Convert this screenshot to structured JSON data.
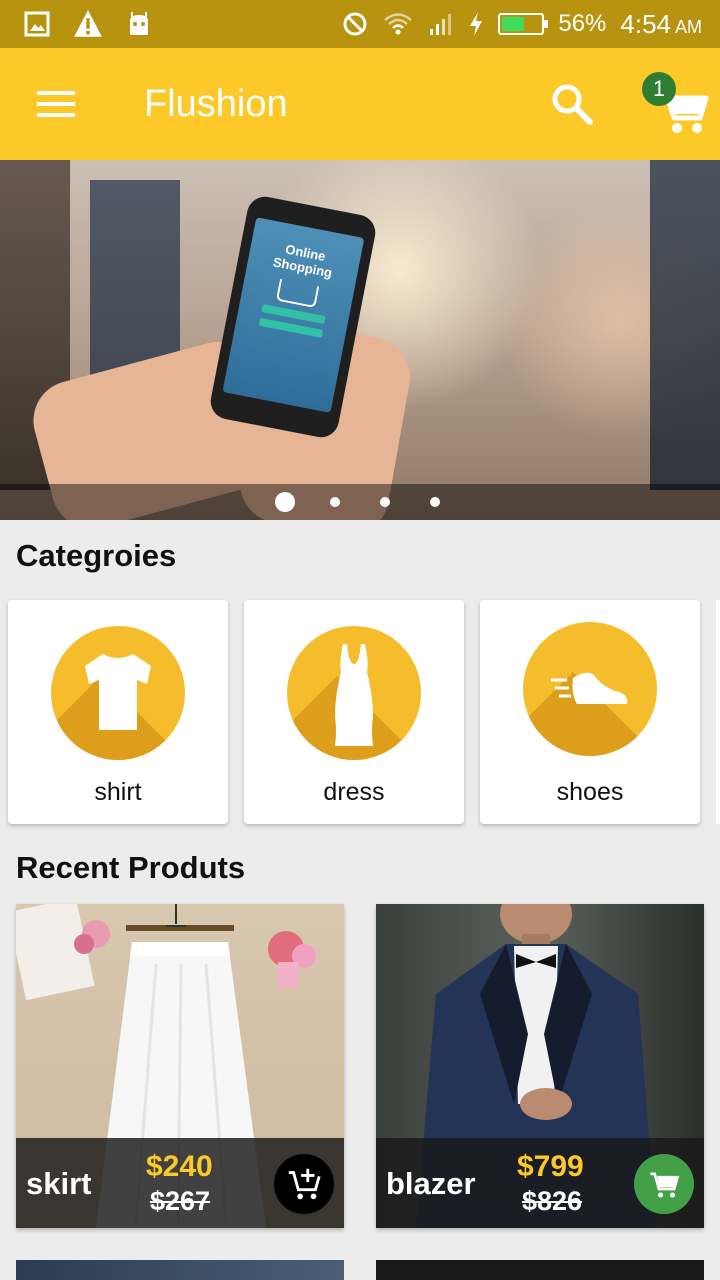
{
  "status_bar": {
    "battery_percent": "56%",
    "battery_level": 0.56,
    "time": "4:54",
    "ampm": "AM",
    "icons": [
      "gallery-icon",
      "warning-icon",
      "android-icon",
      "block-icon",
      "wifi-icon",
      "signal-icon",
      "charging-icon",
      "battery-icon"
    ]
  },
  "app_bar": {
    "title": "Flushion",
    "cart_count": "1",
    "icons": [
      "menu-icon",
      "search-icon",
      "cart-icon"
    ]
  },
  "banner": {
    "phone_text_line1": "Online",
    "phone_text_line2": "Shopping",
    "slides_count": 4,
    "active_slide": 0
  },
  "categories": {
    "title": "Categroies",
    "items": [
      {
        "label": "shirt",
        "icon": "shirt-icon"
      },
      {
        "label": "dress",
        "icon": "dress-icon"
      },
      {
        "label": "shoes",
        "icon": "shoe-icon"
      }
    ]
  },
  "recent": {
    "title": "Recent Produts",
    "products": [
      {
        "name": "skirt",
        "price": "$240",
        "old_price": "$267",
        "in_cart": false
      },
      {
        "name": "blazer",
        "price": "$799",
        "old_price": "$826",
        "in_cart": true
      }
    ]
  },
  "colors": {
    "primary": "#fcc928",
    "status_bar": "#b89310",
    "badge": "#2e7d32",
    "in_cart": "#43a047",
    "add_to_cart": "#000000"
  }
}
